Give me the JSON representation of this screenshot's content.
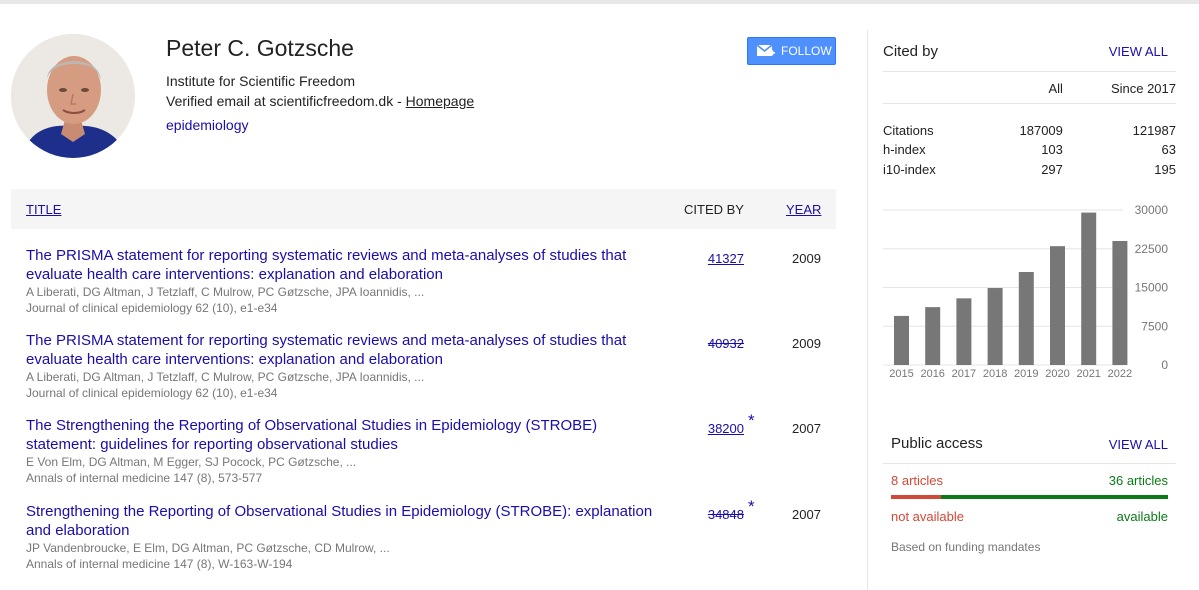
{
  "profile": {
    "name": "Peter C. Gotzsche",
    "affiliation": "Institute for Scientific Freedom",
    "email_prefix": "Verified email at scientificfreedom.dk - ",
    "homepage_label": "Homepage",
    "interest": "epidemiology",
    "follow_label": "FOLLOW",
    "follow_icon": "mail-plus-icon"
  },
  "table": {
    "col_title": "TITLE",
    "col_cited": "CITED BY",
    "col_year": "YEAR"
  },
  "articles": [
    {
      "title": "The PRISMA statement for reporting systematic reviews and meta-analyses of studies that evaluate health care interventions: explanation and elaboration",
      "authors": "A Liberati, DG Altman, J Tetzlaff, C Mulrow, PC Gøtzsche, JPA Ioannidis, ...",
      "venue": "Journal of clinical epidemiology 62 (10), e1-e34",
      "cited": "41327",
      "year": "2009",
      "struck": false,
      "star": ""
    },
    {
      "title": "The PRISMA statement for reporting systematic reviews and meta-analyses of studies that evaluate health care interventions: explanation and elaboration",
      "authors": "A Liberati, DG Altman, J Tetzlaff, C Mulrow, PC Gøtzsche, JPA Ioannidis, ...",
      "venue": "Journal of clinical epidemiology 62 (10), e1-e34",
      "cited": "40932",
      "year": "2009",
      "struck": true,
      "star": ""
    },
    {
      "title": "The Strengthening the Reporting of Observational Studies in Epidemiology (STROBE) statement: guidelines for reporting observational studies",
      "authors": "E Von Elm, DG Altman, M Egger, SJ Pocock, PC Gøtzsche, ...",
      "venue": "Annals of internal medicine 147 (8), 573-577",
      "cited": "38200",
      "year": "2007",
      "struck": false,
      "star": "*"
    },
    {
      "title": "Strengthening the Reporting of Observational Studies in Epidemiology (STROBE): explanation and elaboration",
      "authors": "JP Vandenbroucke, E Elm, DG Altman, PC Gøtzsche, CD Mulrow, ...",
      "venue": "Annals of internal medicine 147 (8), W-163-W-194",
      "cited": "34848",
      "year": "2007",
      "struck": true,
      "star": "*"
    }
  ],
  "cited_by": {
    "title": "Cited by",
    "view_all": "VIEW ALL",
    "col_all": "All",
    "col_since": "Since 2017",
    "rows": [
      {
        "label": "Citations",
        "all": "187009",
        "since": "121987"
      },
      {
        "label": "h-index",
        "all": "103",
        "since": "63"
      },
      {
        "label": "i10-index",
        "all": "297",
        "since": "195"
      }
    ]
  },
  "chart_data": {
    "type": "bar",
    "categories": [
      "2015",
      "2016",
      "2017",
      "2018",
      "2019",
      "2020",
      "2021",
      "2022"
    ],
    "values": [
      9500,
      11200,
      12900,
      14900,
      18000,
      23000,
      29500,
      24000
    ],
    "yticks": [
      "30000",
      "22500",
      "15000",
      "7500",
      "0"
    ],
    "ylim": [
      0,
      30000
    ],
    "bar_color": "#777777"
  },
  "public_access": {
    "title": "Public access",
    "view_all": "VIEW ALL",
    "not_available_count": "8 articles",
    "available_count": "36 articles",
    "not_available_label": "not available",
    "available_label": "available",
    "not_available_fraction": 0.182,
    "note": "Based on funding mandates",
    "colors": {
      "not_available": "#d14836",
      "available": "#0d7a18"
    }
  }
}
